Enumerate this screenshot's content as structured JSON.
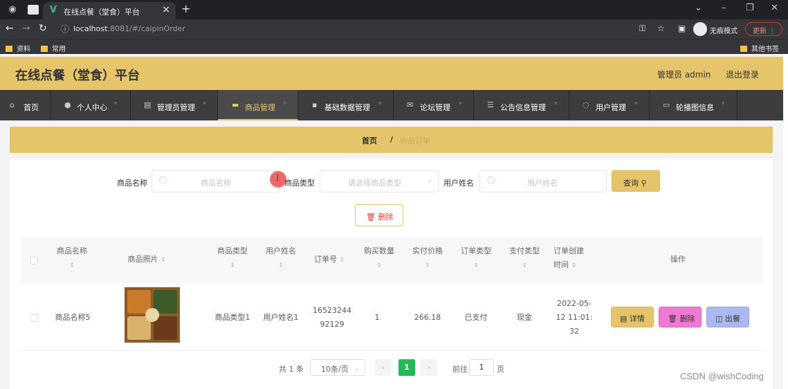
{
  "browser": {
    "tab_title": "在线点餐（堂食）平台",
    "tab_favicon": "V",
    "url_host": "localhost",
    "url_path": ":8081/#/caipinOrder",
    "incognito_label": "无痕模式",
    "update_label": "更新",
    "bookmarks": [
      "资料",
      "常用"
    ],
    "other_bookmarks": "其他书签"
  },
  "header": {
    "title": "在线点餐（堂食）平台",
    "admin": "管理员 admin",
    "logout": "退出登录"
  },
  "nav": {
    "items": [
      {
        "label": "首页",
        "icon": "home-icon"
      },
      {
        "label": "个人中心",
        "icon": "user-icon"
      },
      {
        "label": "管理员管理",
        "icon": "admin-icon"
      },
      {
        "label": "商品管理",
        "icon": "goods-icon"
      },
      {
        "label": "基础数据管理",
        "icon": "data-icon"
      },
      {
        "label": "论坛管理",
        "icon": "forum-icon"
      },
      {
        "label": "公告信息管理",
        "icon": "notice-icon"
      },
      {
        "label": "用户管理",
        "icon": "users-icon"
      },
      {
        "label": "轮播图信息",
        "icon": "carousel-icon"
      }
    ]
  },
  "breadcrumb": {
    "home": "首页",
    "separator": "/",
    "current": "商品订单"
  },
  "search": {
    "name_label": "商品名称",
    "name_placeholder": "商品名称",
    "type_label": "商品类型",
    "type_placeholder": "请选择商品类型",
    "user_label": "用户姓名",
    "user_placeholder": "用户姓名",
    "query_button": "查询"
  },
  "actions": {
    "delete_button": "删除"
  },
  "table": {
    "headers": {
      "name": "商品名称",
      "photo": "商品照片",
      "type": "商品类型",
      "user": "用户姓名",
      "order_no": "订单号",
      "qty": "购买数量",
      "price": "实付价格",
      "order_type": "订单类型",
      "pay_type": "支付类型",
      "created_1": "订单创建",
      "created_2": "时间",
      "ops": "操作"
    },
    "rows": [
      {
        "name": "商品名称5",
        "type": "商品类型1",
        "user": "用户姓名1",
        "order_no_1": "16523244",
        "order_no_2": "92129",
        "qty": "1",
        "price": "266.18",
        "order_type": "已支付",
        "pay_type": "现金",
        "created_1": "2022-05-",
        "created_2": "12 11:01:",
        "created_3": "32",
        "detail": "详情",
        "delete": "删除",
        "serve": "出餐"
      }
    ]
  },
  "pagination": {
    "total": "共 1 条",
    "page_size": "10条/页",
    "current_page": "1",
    "goto_label": "前往",
    "goto_value": "1",
    "page_suffix": "页"
  },
  "watermark": "CSDN @wishCoding"
}
